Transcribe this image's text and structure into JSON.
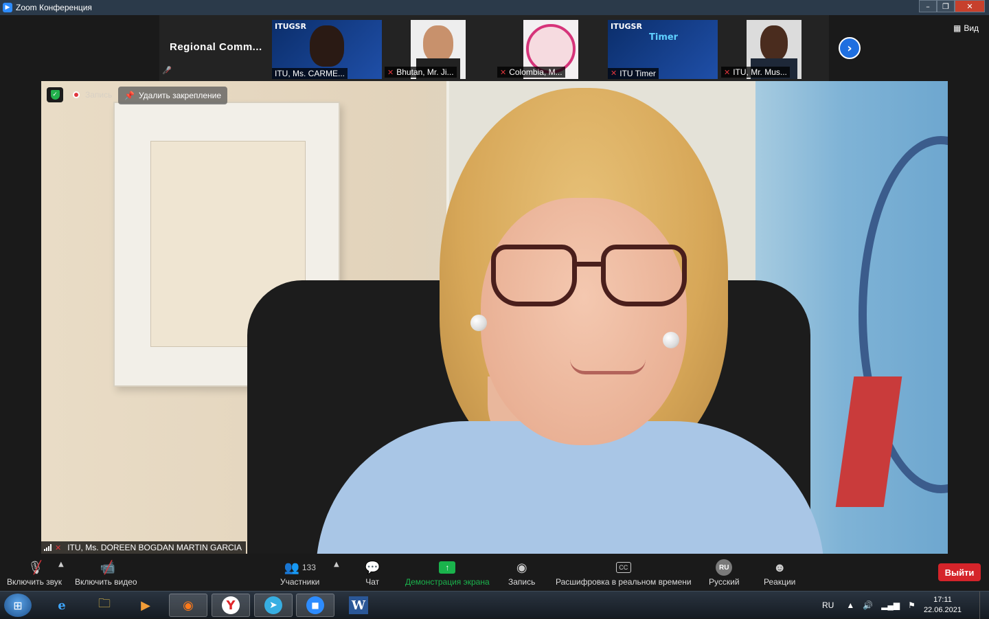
{
  "window": {
    "title": "Zoom Конференция",
    "app_icon": "zoom-camera-icon"
  },
  "strip": {
    "name_tile": "Regional  Comm...",
    "thumbs": [
      {
        "label": "ITU, Ms. CARME...",
        "muted": false,
        "logo": "ITUGSR"
      },
      {
        "label": "Bhutan, Mr. Ji...",
        "muted": true
      },
      {
        "label": "Colombia, M...",
        "muted": true
      },
      {
        "label": "ITU Timer",
        "muted": true,
        "logo": "ITUGSR",
        "overlay": "Timer"
      },
      {
        "label": "ITU, Mr. Mus...",
        "muted": true
      }
    ],
    "next_icon": "chevron-right-icon",
    "view_label": "Вид"
  },
  "main": {
    "speaker_label": "ITU, Ms. DOREEN BOGDAN MARTIN GARCIA",
    "recording_label": "Запись",
    "unpin_label": "Удалить закрепление"
  },
  "toolbar": {
    "unmute": "Включить звук",
    "start_video": "Включить видео",
    "participants": "Участники",
    "participants_count": "133",
    "chat": "Чат",
    "share": "Демонстрация экрана",
    "record": "Запись",
    "captions": "Расшифровка в реальном времени",
    "captions_icon": "CC",
    "language": "Русский",
    "language_icon": "RU",
    "reactions": "Реакции",
    "leave": "Выйти"
  },
  "taskbar": {
    "lang": "RU",
    "time": "17:11",
    "date": "22.06.2021",
    "word_icon_text": "W"
  },
  "colors": {
    "accent": "#2d8cff",
    "leave": "#d5242a",
    "share": "#1ab34c",
    "muted": "#e0363c"
  }
}
